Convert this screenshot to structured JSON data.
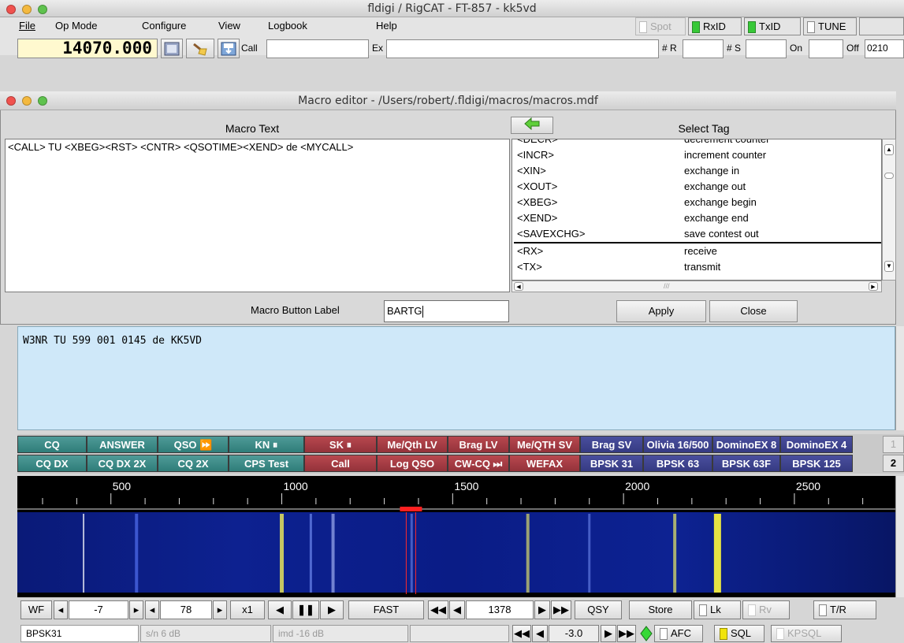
{
  "main_window": {
    "title": "fldigi / RigCAT - FT-857 - kk5vd",
    "menu": [
      "File",
      "Op Mode",
      "Configure",
      "View",
      "Logbook",
      "Help"
    ],
    "toggles": {
      "spot": "Spot",
      "rxid": "RxID",
      "txid": "TxID",
      "tune": "TUNE"
    },
    "frequency": "14070.000",
    "fields": {
      "call_label": "Call",
      "call_value": "",
      "ex_label": "Ex",
      "ex_value": "",
      "r_label": "# R",
      "r_value": "",
      "s_label": "# S",
      "s_value": "",
      "on_label": "On",
      "on_value": "",
      "off_label": "Off",
      "off_value": "0210"
    }
  },
  "macro_editor": {
    "title": "Macro editor - /Users/robert/.fldigi/macros/macros.mdf",
    "macro_text_header": "Macro Text",
    "select_tag_header": "Select Tag",
    "macro_text": "<CALL> TU <XBEG><RST> <CNTR> <QSOTIME><XEND> de <MYCALL>",
    "tags": [
      {
        "tag": "<DECR>",
        "desc": "decrement counter"
      },
      {
        "tag": "<INCR>",
        "desc": "increment counter"
      },
      {
        "tag": "<XIN>",
        "desc": "exchange in"
      },
      {
        "tag": "<XOUT>",
        "desc": "exchange out"
      },
      {
        "tag": "<XBEG>",
        "desc": "exchange begin"
      },
      {
        "tag": "<XEND>",
        "desc": "exchange end"
      },
      {
        "tag": "<SAVEXCHG>",
        "desc": "save contest out"
      },
      {
        "tag": "<RX>",
        "desc": "receive"
      },
      {
        "tag": "<TX>",
        "desc": "transmit"
      }
    ],
    "button_label_caption": "Macro Button Label",
    "button_label_value": "BARTG",
    "apply": "Apply",
    "close": "Close"
  },
  "tx_text": "W3NR TU 599 001 0145 de KK5VD",
  "macros": {
    "row1": [
      {
        "label": "CQ",
        "color": "teal"
      },
      {
        "label": "ANSWER",
        "color": "teal"
      },
      {
        "label": "QSO ⏩",
        "color": "teal"
      },
      {
        "label": "KN ⏸",
        "color": "teal"
      },
      {
        "label": "SK ⏸",
        "color": "red"
      },
      {
        "label": "Me/Qth LV",
        "color": "red"
      },
      {
        "label": "Brag LV",
        "color": "red"
      },
      {
        "label": "Me/QTH SV",
        "color": "red"
      },
      {
        "label": "Brag SV",
        "color": "blue"
      },
      {
        "label": "Olivia 16/500",
        "color": "blue"
      },
      {
        "label": "DominoEX 8",
        "color": "blue"
      },
      {
        "label": "DominoEX 4",
        "color": "blue"
      }
    ],
    "row2": [
      {
        "label": "CQ DX",
        "color": "teal"
      },
      {
        "label": "CQ DX 2X",
        "color": "teal"
      },
      {
        "label": "CQ 2X",
        "color": "teal"
      },
      {
        "label": "CPS Test",
        "color": "teal"
      },
      {
        "label": "Call",
        "color": "red"
      },
      {
        "label": "Log QSO",
        "color": "red"
      },
      {
        "label": "CW-CQ ⏭",
        "color": "red"
      },
      {
        "label": "WEFAX",
        "color": "red"
      },
      {
        "label": "BPSK 31",
        "color": "blue"
      },
      {
        "label": "BPSK 63",
        "color": "blue"
      },
      {
        "label": "BPSK 63F",
        "color": "blue"
      },
      {
        "label": "BPSK 125",
        "color": "blue"
      }
    ],
    "set1": "1",
    "set2": "2"
  },
  "waterfall": {
    "scale_labels": [
      "500",
      "1000",
      "1500",
      "2000",
      "2500"
    ],
    "cursor_hz": 1378
  },
  "wf_controls": {
    "wf": "WF",
    "lower": "-7",
    "range": "78",
    "zoom": "x1",
    "speed": "FAST",
    "freq": "1378",
    "qsy": "QSY",
    "store": "Store",
    "lk": "Lk",
    "rv": "Rv",
    "tr": "T/R"
  },
  "status_bar": {
    "mode": "BPSK31",
    "sn": "s/n  6 dB",
    "imd": "imd -16 dB",
    "blank": "",
    "sql_level": "-3.0",
    "afc": "AFC",
    "sql": "SQL",
    "kpsql": "KPSQL"
  }
}
